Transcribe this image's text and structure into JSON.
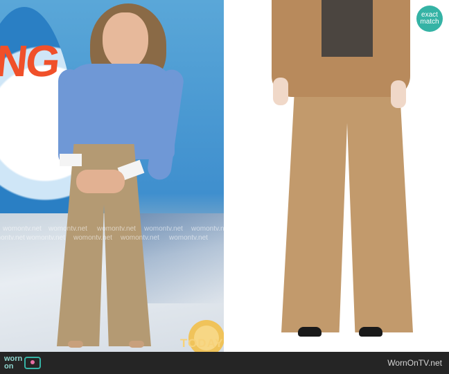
{
  "left_photo": {
    "studio_sign_top": "NG",
    "studio_sign_bottom": "T",
    "show_logo": "TODAY"
  },
  "right_photo": {
    "badge_line1": "exact",
    "badge_line2": "match"
  },
  "watermark": "womontv.net",
  "footer": {
    "brand_line1": "worn",
    "brand_line2": "on",
    "site_name": "WornOnTV.net"
  },
  "colors": {
    "badge": "#35b3a5",
    "footer_bg": "#252525",
    "trousers": "#c29a6c"
  }
}
